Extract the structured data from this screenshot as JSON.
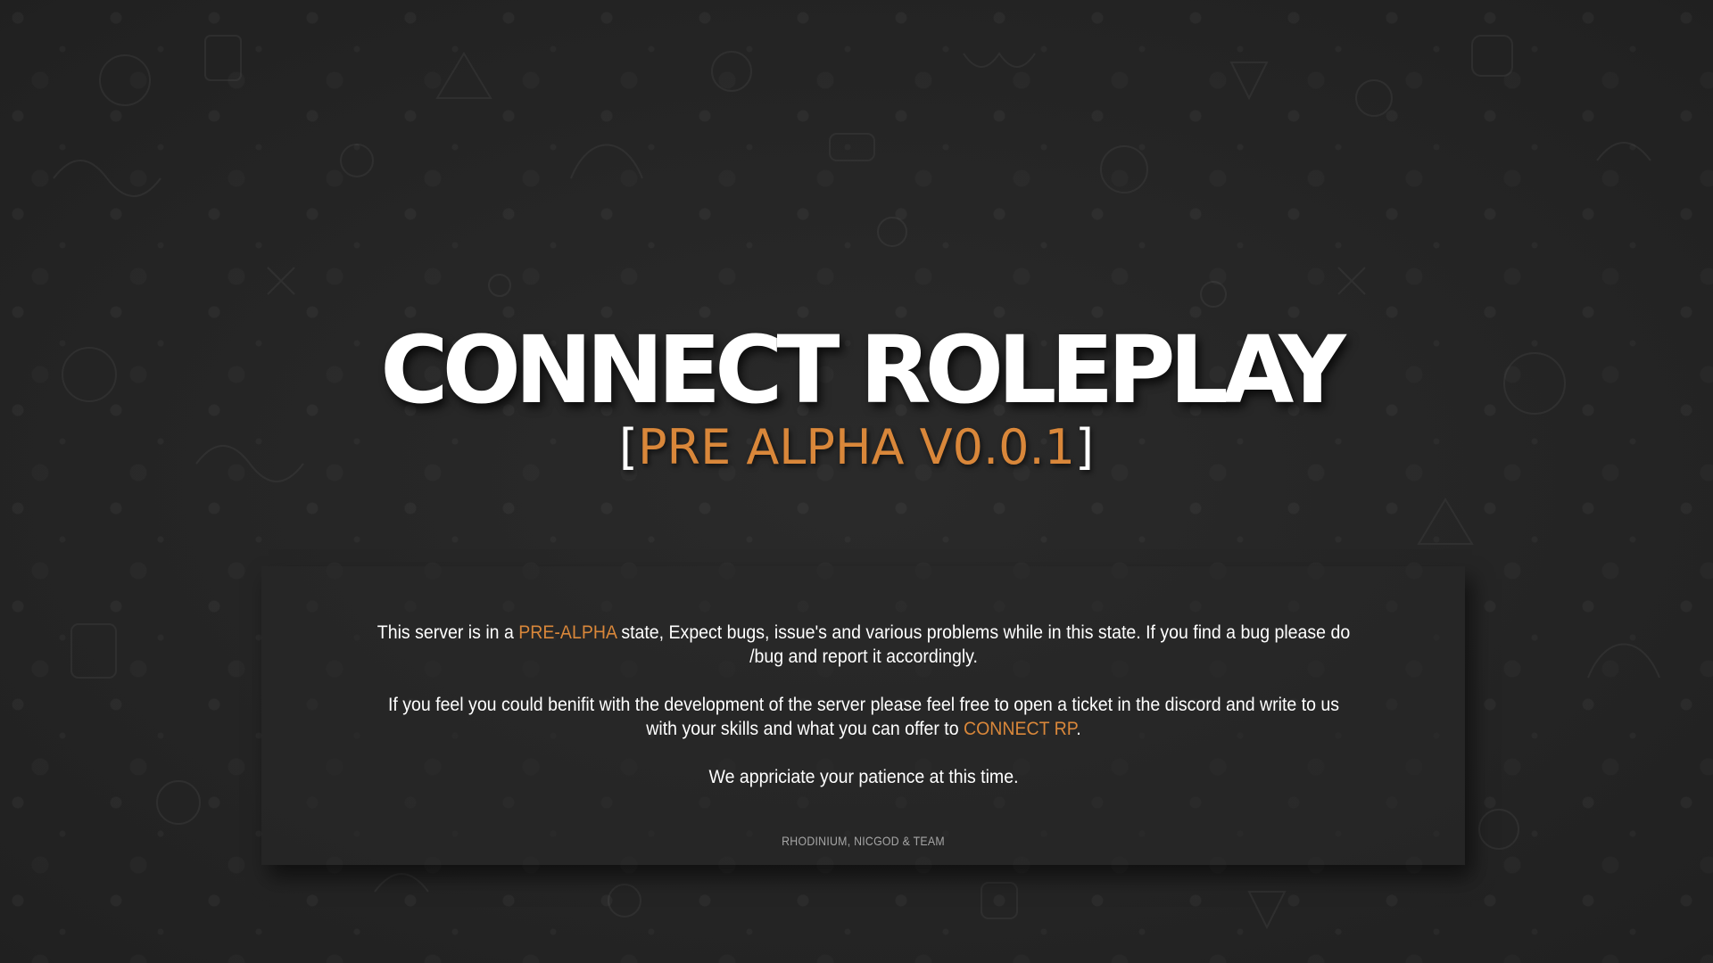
{
  "header": {
    "title": "CONNECT ROLEPLAY",
    "version_open_bracket": "[",
    "version_label": "PRE ALPHA V0.0.1",
    "version_close_bracket": "]"
  },
  "message": {
    "paragraph1": {
      "before": "This server is in a ",
      "highlight": "PRE-ALPHA",
      "after": " state, Expect bugs, issue's and various problems while in this state. If you find a bug please do /bug and report it accordingly."
    },
    "paragraph2": {
      "before": "If you feel you could benifit with the development of the server please feel free to open a ticket in the discord and write to us with your skills and what you can offer to ",
      "highlight": "CONNECT RP",
      "after": "."
    },
    "paragraph3": "We appriciate your patience at this time.",
    "credits": "RHODINIUM, NICGOD & TEAM"
  },
  "colors": {
    "background": "#262626",
    "accent": "#d9873a",
    "text": "#ffffff",
    "muted": "#a6a6a6"
  },
  "icons": {
    "background_pattern": "doodle-pattern-icon"
  }
}
